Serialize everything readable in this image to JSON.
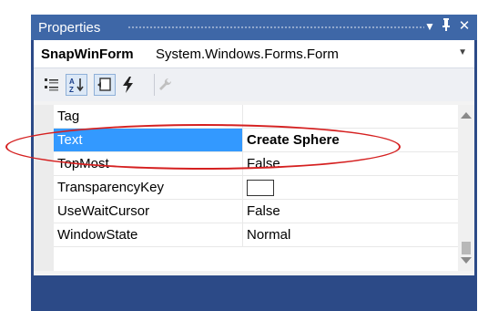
{
  "window": {
    "title": "Properties",
    "pin_glyph": "▾",
    "autohide_glyph": "⸾",
    "close_glyph": "✕"
  },
  "object_selector": {
    "name": "SnapWinForm",
    "type": "System.Windows.Forms.Form"
  },
  "toolbar": {
    "buttons": [
      {
        "name": "categorized",
        "icon": "categorized-icon"
      },
      {
        "name": "alphabetical",
        "icon": "sort-az-icon",
        "active": true
      },
      {
        "name": "properties",
        "icon": "properties-icon",
        "active": true
      },
      {
        "name": "events",
        "icon": "lightning-icon"
      },
      {
        "name": "property-pages",
        "icon": "wrench-icon"
      }
    ]
  },
  "properties": [
    {
      "name": "Tag",
      "value": ""
    },
    {
      "name": "Text",
      "value": "Create Sphere",
      "selected": true
    },
    {
      "name": "TopMost",
      "value": "False"
    },
    {
      "name": "TransparencyKey",
      "value": "",
      "swatch": true
    },
    {
      "name": "UseWaitCursor",
      "value": "False"
    },
    {
      "name": "WindowState",
      "value": "Normal"
    }
  ],
  "colors": {
    "selection": "#3399ff",
    "titlebar": "#3e67a7",
    "frame": "#2c4a87",
    "annotation": "#d52020"
  }
}
